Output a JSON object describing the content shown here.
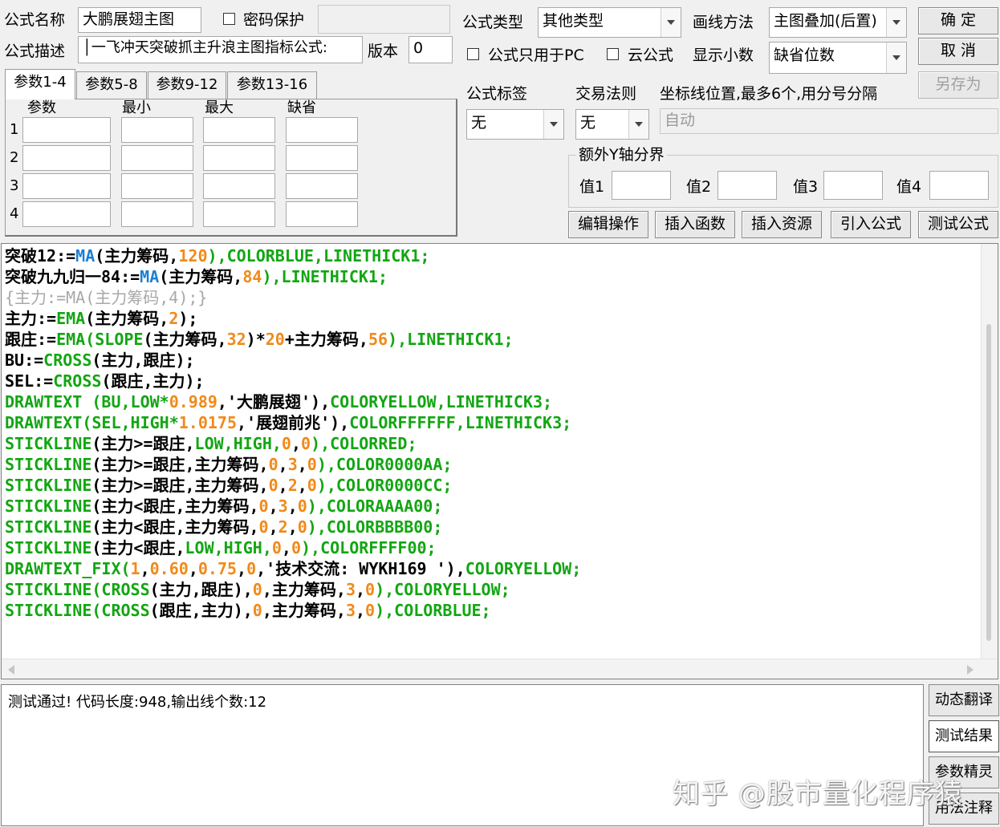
{
  "header": {
    "name_label": "公式名称",
    "name_value": "大鹏展翅主图",
    "password_label": "密码保护",
    "password_value": "",
    "desc_label": "公式描述",
    "desc_value": "│一飞冲天突破抓主升浪主图指标公式:",
    "version_label": "版本",
    "version_value": "0"
  },
  "options": {
    "type_label": "公式类型",
    "type_value": "其他类型",
    "draw_label": "画线方法",
    "draw_value": "主图叠加(后置)",
    "pc_only_label": "公式只用于PC",
    "cloud_label": "云公式",
    "decimal_label": "显示小数",
    "decimal_value": "缺省位数",
    "tag_label": "公式标签",
    "tag_value": "无",
    "rule_label": "交易法则",
    "rule_value": "无",
    "coord_label": "坐标线位置,最多6个,用分号分隔",
    "coord_value": "自动",
    "yaxis_legend": "额外Y轴分界",
    "y_values": [
      "值1",
      "值2",
      "值3",
      "值4"
    ]
  },
  "buttons": {
    "ok": "确  定",
    "cancel": "取  消",
    "save_as": "另存为",
    "edit": "编辑操作",
    "insert_func": "插入函数",
    "insert_res": "插入资源",
    "import": "引入公式",
    "test": "测试公式"
  },
  "params": {
    "tabs": [
      "参数1-4",
      "参数5-8",
      "参数9-12",
      "参数13-16"
    ],
    "columns": [
      "参数",
      "最小",
      "最大",
      "缺省"
    ],
    "rows": [
      "1",
      "2",
      "3",
      "4"
    ]
  },
  "code_lines": [
    [
      {
        "t": "突破12:=",
        "c": "k"
      },
      {
        "t": "MA",
        "c": "f"
      },
      {
        "t": "(主力筹码,",
        "c": "k"
      },
      {
        "t": "120",
        "c": "n"
      },
      {
        "t": "),COLORBLUE,LINETHICK1;",
        "c": "g"
      }
    ],
    [
      {
        "t": "突破九九归一84:=",
        "c": "k"
      },
      {
        "t": "MA",
        "c": "f"
      },
      {
        "t": "(主力筹码,",
        "c": "k"
      },
      {
        "t": "84",
        "c": "n"
      },
      {
        "t": "),LINETHICK1;",
        "c": "g"
      }
    ],
    [
      {
        "t": "{主力:=MA(主力筹码,4);}",
        "c": "c"
      }
    ],
    [
      {
        "t": "主力:=",
        "c": "k"
      },
      {
        "t": "EMA",
        "c": "g"
      },
      {
        "t": "(主力筹码,",
        "c": "k"
      },
      {
        "t": "2",
        "c": "n"
      },
      {
        "t": ");",
        "c": "k"
      }
    ],
    [
      {
        "t": "跟庄:=",
        "c": "k"
      },
      {
        "t": "EMA(SLOPE",
        "c": "g"
      },
      {
        "t": "(主力筹码,",
        "c": "k"
      },
      {
        "t": "32",
        "c": "n"
      },
      {
        "t": ")*",
        "c": "k"
      },
      {
        "t": "20",
        "c": "n"
      },
      {
        "t": "+主力筹码,",
        "c": "k"
      },
      {
        "t": "56",
        "c": "n"
      },
      {
        "t": "),LINETHICK1;",
        "c": "g"
      }
    ],
    [
      {
        "t": "BU:=",
        "c": "k"
      },
      {
        "t": "CROSS",
        "c": "g"
      },
      {
        "t": "(主力,跟庄);",
        "c": "k"
      }
    ],
    [
      {
        "t": "SEL:=",
        "c": "k"
      },
      {
        "t": "CROSS",
        "c": "g"
      },
      {
        "t": "(跟庄,主力);",
        "c": "k"
      }
    ],
    [
      {
        "t": "DRAWTEXT (BU,LOW*",
        "c": "g"
      },
      {
        "t": "0.989",
        "c": "n"
      },
      {
        "t": ",'大鹏展翅'),",
        "c": "k"
      },
      {
        "t": "COLORYELLOW,LINETHICK3;",
        "c": "g"
      }
    ],
    [
      {
        "t": "DRAWTEXT(SEL,HIGH*",
        "c": "g"
      },
      {
        "t": "1.0175",
        "c": "n"
      },
      {
        "t": ",'展翅前兆'),",
        "c": "k"
      },
      {
        "t": "COLORFFFFFF,LINETHICK3;",
        "c": "g"
      }
    ],
    [
      {
        "t": "STICKLINE",
        "c": "g"
      },
      {
        "t": "(主力>=跟庄,",
        "c": "k"
      },
      {
        "t": "LOW,HIGH,",
        "c": "g"
      },
      {
        "t": "0",
        "c": "n"
      },
      {
        "t": ",",
        "c": "k"
      },
      {
        "t": "0",
        "c": "n"
      },
      {
        "t": "),COLORRED;",
        "c": "g"
      }
    ],
    [
      {
        "t": "STICKLINE",
        "c": "g"
      },
      {
        "t": "(主力>=跟庄,主力筹码,",
        "c": "k"
      },
      {
        "t": "0",
        "c": "n"
      },
      {
        "t": ",",
        "c": "k"
      },
      {
        "t": "3",
        "c": "n"
      },
      {
        "t": ",",
        "c": "k"
      },
      {
        "t": "0",
        "c": "n"
      },
      {
        "t": "),COLOR0000AA;",
        "c": "g"
      }
    ],
    [
      {
        "t": "STICKLINE",
        "c": "g"
      },
      {
        "t": "(主力>=跟庄,主力筹码,",
        "c": "k"
      },
      {
        "t": "0",
        "c": "n"
      },
      {
        "t": ",",
        "c": "k"
      },
      {
        "t": "2",
        "c": "n"
      },
      {
        "t": ",",
        "c": "k"
      },
      {
        "t": "0",
        "c": "n"
      },
      {
        "t": "),COLOR0000CC;",
        "c": "g"
      }
    ],
    [
      {
        "t": "STICKLINE",
        "c": "g"
      },
      {
        "t": "(主力<跟庄,主力筹码,",
        "c": "k"
      },
      {
        "t": "0",
        "c": "n"
      },
      {
        "t": ",",
        "c": "k"
      },
      {
        "t": "3",
        "c": "n"
      },
      {
        "t": ",",
        "c": "k"
      },
      {
        "t": "0",
        "c": "n"
      },
      {
        "t": "),COLORAAAA00;",
        "c": "g"
      }
    ],
    [
      {
        "t": "STICKLINE",
        "c": "g"
      },
      {
        "t": "(主力<跟庄,主力筹码,",
        "c": "k"
      },
      {
        "t": "0",
        "c": "n"
      },
      {
        "t": ",",
        "c": "k"
      },
      {
        "t": "2",
        "c": "n"
      },
      {
        "t": ",",
        "c": "k"
      },
      {
        "t": "0",
        "c": "n"
      },
      {
        "t": "),COLORBBBB00;",
        "c": "g"
      }
    ],
    [
      {
        "t": "STICKLINE",
        "c": "g"
      },
      {
        "t": "(主力<跟庄,",
        "c": "k"
      },
      {
        "t": "LOW,HIGH,",
        "c": "g"
      },
      {
        "t": "0",
        "c": "n"
      },
      {
        "t": ",",
        "c": "k"
      },
      {
        "t": "0",
        "c": "n"
      },
      {
        "t": "),COLORFFFF00;",
        "c": "g"
      }
    ],
    [
      {
        "t": "DRAWTEXT_FIX(",
        "c": "g"
      },
      {
        "t": "1",
        "c": "n"
      },
      {
        "t": ",",
        "c": "k"
      },
      {
        "t": "0.60",
        "c": "n"
      },
      {
        "t": ",",
        "c": "k"
      },
      {
        "t": "0.75",
        "c": "n"
      },
      {
        "t": ",",
        "c": "k"
      },
      {
        "t": "0",
        "c": "n"
      },
      {
        "t": ",'技术交流: WYKH169 '),",
        "c": "k"
      },
      {
        "t": "COLORYELLOW;",
        "c": "g"
      }
    ],
    [
      {
        "t": "STICKLINE(CROSS",
        "c": "g"
      },
      {
        "t": "(主力,跟庄),",
        "c": "k"
      },
      {
        "t": "0",
        "c": "n"
      },
      {
        "t": ",主力筹码,",
        "c": "k"
      },
      {
        "t": "3",
        "c": "n"
      },
      {
        "t": ",",
        "c": "k"
      },
      {
        "t": "0",
        "c": "n"
      },
      {
        "t": "),COLORYELLOW;",
        "c": "g"
      }
    ],
    [
      {
        "t": "STICKLINE(CROSS",
        "c": "g"
      },
      {
        "t": "(跟庄,主力),",
        "c": "k"
      },
      {
        "t": "0",
        "c": "n"
      },
      {
        "t": ",主力筹码,",
        "c": "k"
      },
      {
        "t": "3",
        "c": "n"
      },
      {
        "t": ",",
        "c": "k"
      },
      {
        "t": "0",
        "c": "n"
      },
      {
        "t": "),COLORBLUE;",
        "c": "g"
      }
    ]
  ],
  "code_colors": {
    "k": "#000000",
    "f": "#1a7fd4",
    "g": "#12a612",
    "n": "#f08a1a",
    "c": "#a8a8a8"
  },
  "output": {
    "message": "测试通过! 代码长度:948,输出线个数:12"
  },
  "side_tabs": [
    "动态翻译",
    "测试结果",
    "参数精灵",
    "用法注释"
  ],
  "watermark": "知乎 @股市量化程序猿"
}
